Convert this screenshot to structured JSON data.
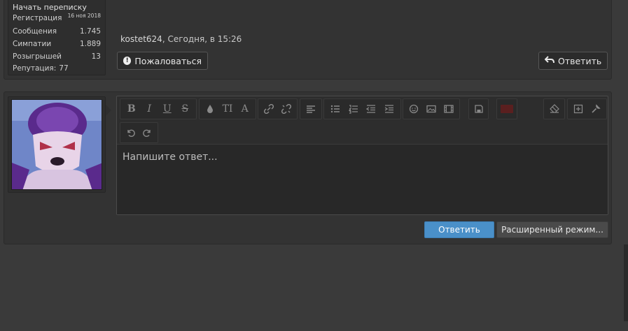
{
  "user_stats": {
    "start_conversation": "Начать переписку",
    "rows": [
      {
        "label": "Регистрация",
        "value": "16 ноя 2018"
      },
      {
        "label": "Сообщения",
        "value": "1.745"
      },
      {
        "label": "Симпатии",
        "value": "1.889"
      },
      {
        "label": "Розыгрышей",
        "value": "13"
      },
      {
        "label": "Репутация",
        "value": "77"
      }
    ]
  },
  "post": {
    "author": "kostet624",
    "time": ", Сегодня, в 15:26",
    "report_label": "Пожаловаться",
    "reply_label": "Ответить"
  },
  "editor": {
    "placeholder": "Напишите ответ...",
    "toolbar_icons": [
      "bold-icon",
      "italic-icon",
      "underline-icon",
      "strike-icon",
      "color-icon",
      "font-size-icon",
      "font-icon",
      "link-icon",
      "unlink-icon",
      "align-icon",
      "bullet-list-icon",
      "numbered-list-icon",
      "outdent-icon",
      "indent-icon",
      "smilie-icon",
      "image-icon",
      "media-icon",
      "save-icon",
      "code-icon",
      "remove-format-icon",
      "insert-icon",
      "settings-icon",
      "undo-icon",
      "redo-icon"
    ]
  },
  "actions": {
    "reply": "Ответить",
    "extended": "Расширенный режим..."
  },
  "colors": {
    "background": "#3a3a3a",
    "accent": "#4a90c9"
  }
}
